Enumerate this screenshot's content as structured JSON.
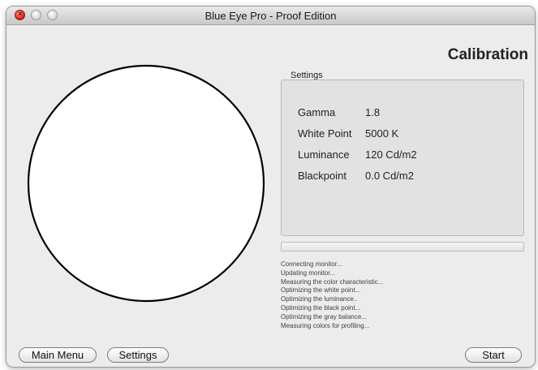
{
  "window": {
    "title": "Blue Eye Pro - Proof Edition"
  },
  "heading": "Calibration",
  "settings": {
    "legend": "Settings",
    "rows": [
      {
        "label": "Gamma",
        "value": "1.8"
      },
      {
        "label": "White Point",
        "value": "5000 K"
      },
      {
        "label": "Luminance",
        "value": "120 Cd/m2"
      },
      {
        "label": "Blackpoint",
        "value": "0.0 Cd/m2"
      }
    ]
  },
  "progress": {
    "fraction": 0.0
  },
  "log": [
    "Connecting monitor...",
    "Updating monitor...",
    "Measuring the color characteristic...",
    "Optimizing the white point...",
    "Optimizing the luminance..",
    "Optimizing the black point...",
    "Optimizing the gray balance...",
    "Measuring colors for profiling..."
  ],
  "buttons": {
    "main_menu": "Main Menu",
    "settings": "Settings",
    "start": "Start"
  },
  "colors": {
    "close": "#e0281c",
    "window_bg": "#ececec",
    "panel_bg": "#e2e2e2"
  }
}
